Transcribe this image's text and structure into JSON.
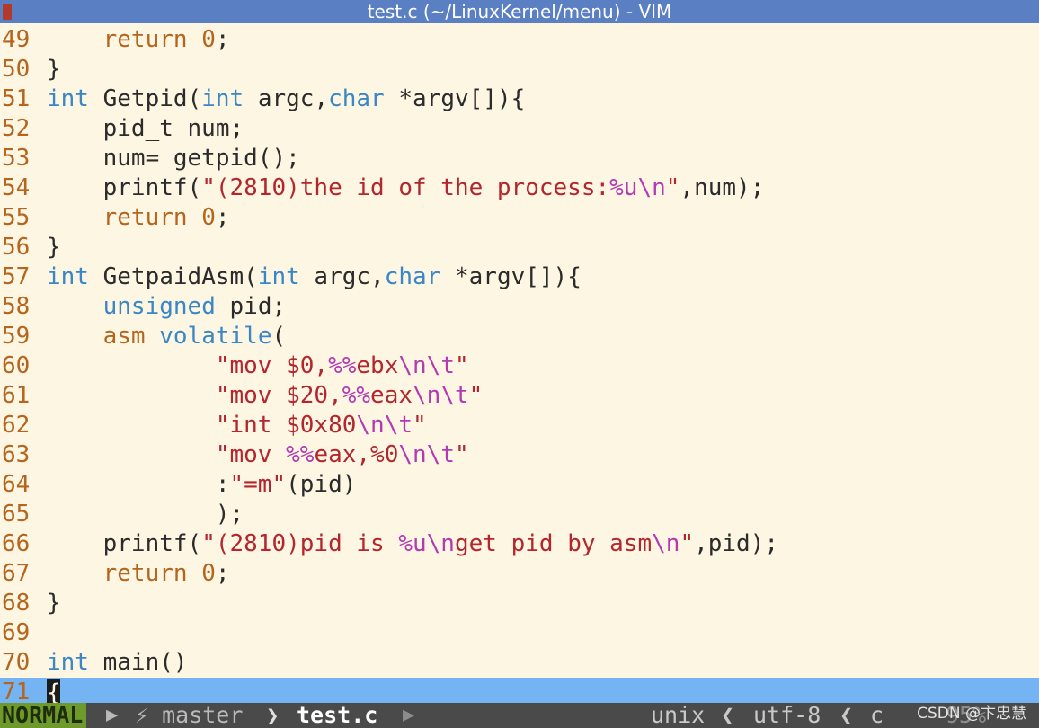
{
  "window": {
    "title": "test.c (~/LinuxKernel/menu) - VIM"
  },
  "colors": {
    "type_keyword": "#3a86c6",
    "return_keyword": "#b5651d",
    "string": "#b3262e",
    "escape": "#b33ab3",
    "line_number": "#b5651d",
    "cursorline": "#74b4f2",
    "mode_bg": "#6e9a2c"
  },
  "lines": [
    {
      "num": "49",
      "tokens": [
        [
          "plain",
          "    "
        ],
        [
          "kw-ret",
          "return"
        ],
        [
          "plain",
          " "
        ],
        [
          "kw-ret",
          "0"
        ],
        [
          "plain",
          ";"
        ]
      ]
    },
    {
      "num": "50",
      "tokens": [
        [
          "plain",
          "}"
        ]
      ]
    },
    {
      "num": "51",
      "tokens": [
        [
          "kw-type",
          "int"
        ],
        [
          "plain",
          " Getpid("
        ],
        [
          "kw-type",
          "int"
        ],
        [
          "plain",
          " argc,"
        ],
        [
          "kw-type",
          "char"
        ],
        [
          "plain",
          " *argv[]){"
        ]
      ]
    },
    {
      "num": "52",
      "tokens": [
        [
          "plain",
          "    pid_t num;"
        ]
      ]
    },
    {
      "num": "53",
      "tokens": [
        [
          "plain",
          "    num= getpid();"
        ]
      ]
    },
    {
      "num": "54",
      "tokens": [
        [
          "plain",
          "    printf("
        ],
        [
          "str",
          "\"(2810)the id of the process:"
        ],
        [
          "esc",
          "%u\\n"
        ],
        [
          "str",
          "\""
        ],
        [
          "plain",
          ",num);"
        ]
      ]
    },
    {
      "num": "55",
      "tokens": [
        [
          "plain",
          "    "
        ],
        [
          "kw-ret",
          "return"
        ],
        [
          "plain",
          " "
        ],
        [
          "kw-ret",
          "0"
        ],
        [
          "plain",
          ";"
        ]
      ]
    },
    {
      "num": "56",
      "tokens": [
        [
          "plain",
          "}"
        ]
      ]
    },
    {
      "num": "57",
      "tokens": [
        [
          "kw-type",
          "int"
        ],
        [
          "plain",
          " GetpaidAsm("
        ],
        [
          "kw-type",
          "int"
        ],
        [
          "plain",
          " argc,"
        ],
        [
          "kw-type",
          "char"
        ],
        [
          "plain",
          " *argv[]){"
        ]
      ]
    },
    {
      "num": "58",
      "tokens": [
        [
          "plain",
          "    "
        ],
        [
          "kw-type",
          "unsigned"
        ],
        [
          "plain",
          " pid;"
        ]
      ]
    },
    {
      "num": "59",
      "tokens": [
        [
          "plain",
          "    "
        ],
        [
          "kw-ret",
          "asm"
        ],
        [
          "plain",
          " "
        ],
        [
          "kw-type",
          "volatile"
        ],
        [
          "plain",
          "("
        ]
      ]
    },
    {
      "num": "60",
      "tokens": [
        [
          "plain",
          "            "
        ],
        [
          "str",
          "\"mov $0,"
        ],
        [
          "esc",
          "%%"
        ],
        [
          "str",
          "ebx"
        ],
        [
          "esc",
          "\\n\\t"
        ],
        [
          "str",
          "\""
        ]
      ]
    },
    {
      "num": "61",
      "tokens": [
        [
          "plain",
          "            "
        ],
        [
          "str",
          "\"mov $20,"
        ],
        [
          "esc",
          "%%"
        ],
        [
          "str",
          "eax"
        ],
        [
          "esc",
          "\\n\\t"
        ],
        [
          "str",
          "\""
        ]
      ]
    },
    {
      "num": "62",
      "tokens": [
        [
          "plain",
          "            "
        ],
        [
          "str",
          "\"int $0x80"
        ],
        [
          "esc",
          "\\n\\t"
        ],
        [
          "str",
          "\""
        ]
      ]
    },
    {
      "num": "63",
      "tokens": [
        [
          "plain",
          "            "
        ],
        [
          "str",
          "\"mov "
        ],
        [
          "esc",
          "%%"
        ],
        [
          "str",
          "eax,%0"
        ],
        [
          "esc",
          "\\n\\t"
        ],
        [
          "str",
          "\""
        ]
      ]
    },
    {
      "num": "64",
      "tokens": [
        [
          "plain",
          "            :"
        ],
        [
          "str",
          "\"=m\""
        ],
        [
          "plain",
          "(pid)"
        ]
      ]
    },
    {
      "num": "65",
      "tokens": [
        [
          "plain",
          "            );"
        ]
      ]
    },
    {
      "num": "66",
      "tokens": [
        [
          "plain",
          "    printf("
        ],
        [
          "str",
          "\"(2810)pid is "
        ],
        [
          "esc",
          "%u\\n"
        ],
        [
          "str",
          "get pid by asm"
        ],
        [
          "esc",
          "\\n"
        ],
        [
          "str",
          "\""
        ],
        [
          "plain",
          ",pid);"
        ]
      ]
    },
    {
      "num": "67",
      "tokens": [
        [
          "plain",
          "    "
        ],
        [
          "kw-ret",
          "return"
        ],
        [
          "plain",
          " "
        ],
        [
          "kw-ret",
          "0"
        ],
        [
          "plain",
          ";"
        ]
      ]
    },
    {
      "num": "68",
      "tokens": [
        [
          "plain",
          "}"
        ]
      ]
    },
    {
      "num": "69",
      "tokens": []
    },
    {
      "num": "70",
      "tokens": [
        [
          "kw-type",
          "int"
        ],
        [
          "plain",
          " main()"
        ]
      ]
    },
    {
      "num": "71",
      "tokens": [],
      "cursor": "{",
      "current": true
    }
  ],
  "statusline": {
    "mode": "NORMAL",
    "branch": "⚡ master",
    "separator": "❯",
    "filename": "test.c",
    "fileformat": "unix",
    "separator_left": "❮",
    "encoding": "utf-8",
    "filetype": "c",
    "percent": "95%"
  },
  "watermark": "CSDN @卞忠慧"
}
